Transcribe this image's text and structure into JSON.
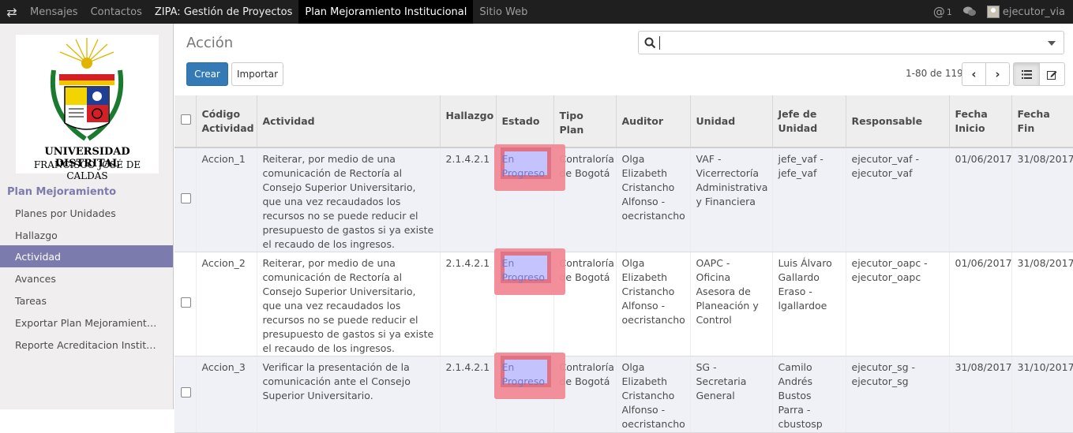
{
  "topnav": {
    "items": [
      "Mensajes",
      "Contactos",
      "ZIPA: Gestión de Proyectos",
      "Plan Mejoramiento Institucional",
      "Sitio Web"
    ],
    "notifications": "1",
    "user": "ejecutor_via"
  },
  "sidebar": {
    "logo_line1": "UNIVERSIDAD DISTRITAL",
    "logo_line2": "FRANCISCO JOSÉ DE CALDAS",
    "section": "Plan Mejoramiento",
    "items": [
      "Planes por Unidades",
      "Hallazgo",
      "Actividad",
      "Avances",
      "Tareas",
      "Exportar Plan Mejoramient…",
      "Reporte Acreditacion Instit…"
    ],
    "active_item": "Actividad"
  },
  "page": {
    "title": "Acción",
    "create_label": "Crear",
    "import_label": "Importar",
    "pager": "1-80 de 119"
  },
  "table": {
    "headers": [
      "Código Actividad",
      "Actividad",
      "Hallazgo",
      "Estado",
      "Tipo Plan",
      "Auditor",
      "Unidad",
      "Jefe de Unidad",
      "Responsable",
      "Fecha Inicio",
      "Fecha Fin"
    ],
    "rows": [
      {
        "codigo": "Accion_1",
        "actividad": "Reiterar, por medio de una comunicación de Rectoría al Consejo Superior Universitario, que una vez recaudados los recursos no se puede reducir el presupuesto de gastos si ya existe el recaudo de los ingresos.",
        "hallazgo": "2.1.4.2.1",
        "estado": "En Progreso",
        "tipo_plan": "Contraloría de Bogotá",
        "auditor": "Olga Elizabeth Cristancho Alfonso - oecristancho",
        "unidad": "VAF - Vicerrectoría Administrativa y Financiera",
        "jefe": "jefe_vaf - jefe_vaf",
        "responsable": "ejecutor_vaf - ejecutor_vaf",
        "fecha_inicio": "01/06/2017",
        "fecha_fin": "31/08/2017"
      },
      {
        "codigo": "Accion_2",
        "actividad": "Reiterar, por medio de una comunicación de Rectoría al Consejo Superior Universitario, que una vez recaudados los recursos no se puede reducir el presupuesto de gastos si ya existe el recaudo de los ingresos.",
        "hallazgo": "2.1.4.2.1",
        "estado": "En Progreso",
        "tipo_plan": "Contraloría de Bogotá",
        "auditor": "Olga Elizabeth Cristancho Alfonso - oecristancho",
        "unidad": "OAPC - Oficina Asesora de Planeación y Control",
        "jefe": "Luis Álvaro Gallardo Eraso - lgallardoe",
        "responsable": "ejecutor_oapc - ejecutor_oapc",
        "fecha_inicio": "01/06/2017",
        "fecha_fin": "31/08/2017"
      },
      {
        "codigo": "Accion_3",
        "actividad": "Verificar la presentación de la comunicación ante el Consejo Superior Universitario.",
        "hallazgo": "2.1.4.2.1",
        "estado": "En Progreso",
        "tipo_plan": "Contraloría de Bogotá",
        "auditor": "Olga Elizabeth Cristancho Alfonso - oecristancho",
        "unidad": "SG - Secretaria General",
        "jefe": "Camilo Andrés Bustos Parra - cbustosp",
        "responsable": "ejecutor_sg - ejecutor_sg",
        "fecha_inicio": "31/08/2017",
        "fecha_fin": "31/10/2017"
      }
    ]
  },
  "colors": {
    "topbar": "#1f1f1f",
    "sidebar_active": "#7c7bad",
    "primary_button": "#337ab7",
    "highlight": "#f28a96"
  }
}
